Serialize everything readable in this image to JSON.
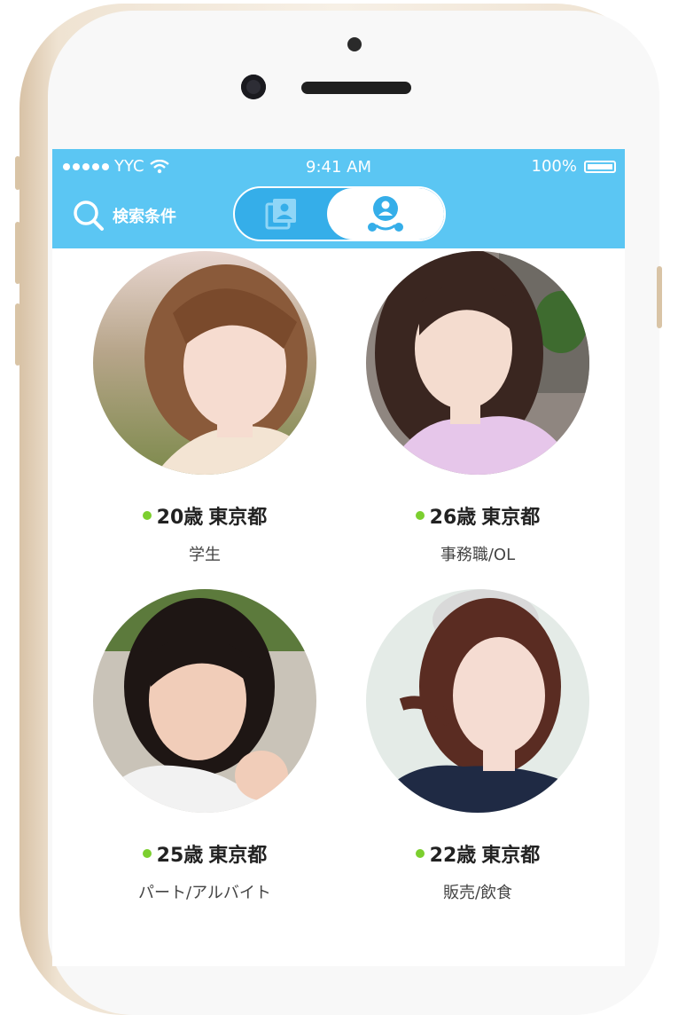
{
  "status_bar": {
    "carrier": "YYC",
    "time": "9:41 AM",
    "battery": "100%"
  },
  "navbar": {
    "search_label": "検索条件",
    "toggle": {
      "left_icon": "album-icon",
      "right_icon": "user-group-icon",
      "selected": "right"
    }
  },
  "profiles": [
    {
      "age": "20歳",
      "location": "東京都",
      "occupation": "学生",
      "online": true
    },
    {
      "age": "26歳",
      "location": "東京都",
      "occupation": "事務職/OL",
      "online": true
    },
    {
      "age": "25歳",
      "location": "東京都",
      "occupation": "パート/アルバイト",
      "online": true
    },
    {
      "age": "22歳",
      "location": "東京都",
      "occupation": "販売/飲食",
      "online": true
    }
  ],
  "colors": {
    "accent": "#5bc6f3",
    "accent_dark": "#35aee9",
    "online": "#7ccf2f"
  }
}
